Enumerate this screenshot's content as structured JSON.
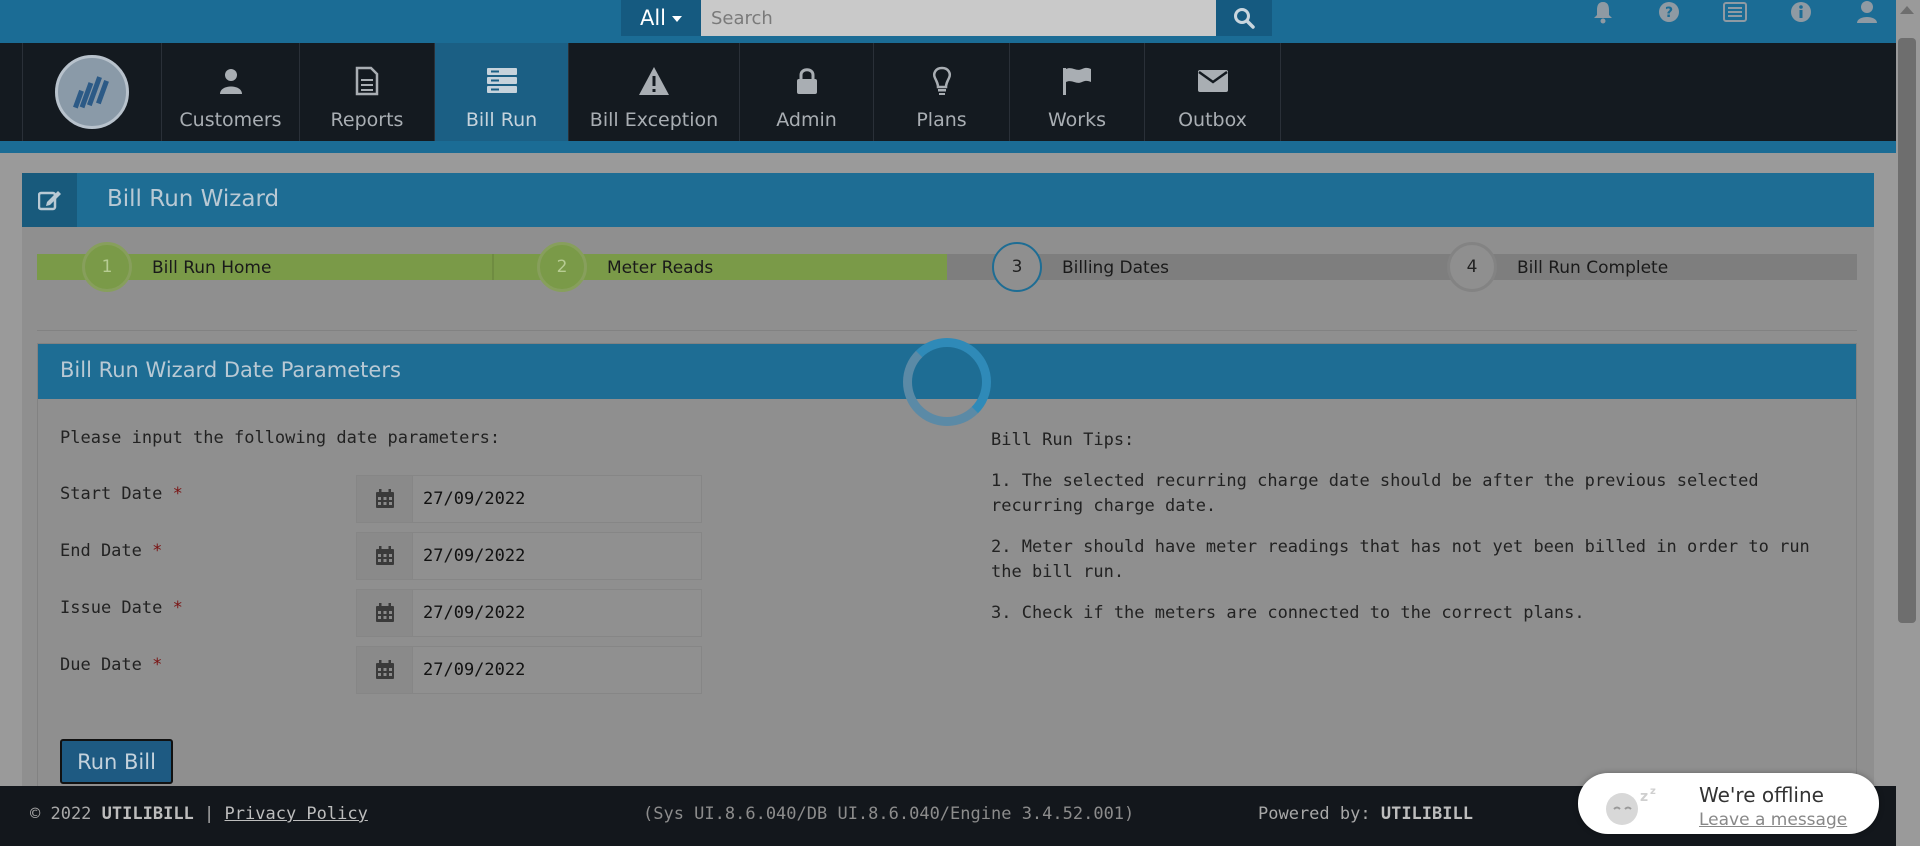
{
  "search": {
    "scope_label": "All",
    "placeholder": "Search"
  },
  "top_icons": [
    "bell-icon",
    "question-icon",
    "list-icon",
    "info-icon",
    "user-icon"
  ],
  "nav": {
    "items": [
      {
        "label": "Customers",
        "icon": "user-icon"
      },
      {
        "label": "Reports",
        "icon": "document-icon"
      },
      {
        "label": "Bill Run",
        "icon": "server-icon",
        "active": true
      },
      {
        "label": "Bill Exception",
        "icon": "warning-icon"
      },
      {
        "label": "Admin",
        "icon": "lock-icon"
      },
      {
        "label": "Plans",
        "icon": "lightbulb-icon"
      },
      {
        "label": "Works",
        "icon": "flag-icon"
      },
      {
        "label": "Outbox",
        "icon": "envelope-icon"
      }
    ]
  },
  "panel": {
    "title": "Bill Run Wizard"
  },
  "wizard": {
    "steps": [
      {
        "number": "1",
        "label": "Bill Run Home",
        "state": "done"
      },
      {
        "number": "2",
        "label": "Meter Reads",
        "state": "done"
      },
      {
        "number": "3",
        "label": "Billing Dates",
        "state": "current"
      },
      {
        "number": "4",
        "label": "Bill Run Complete",
        "state": "todo"
      }
    ]
  },
  "form": {
    "title": "Bill Run Wizard Date Parameters",
    "intro": "Please input the following date parameters:",
    "fields": [
      {
        "label": "Start Date",
        "required_mark": "*",
        "value": "27/09/2022"
      },
      {
        "label": "End Date",
        "required_mark": "*",
        "value": "27/09/2022"
      },
      {
        "label": "Issue Date",
        "required_mark": "*",
        "value": "27/09/2022"
      },
      {
        "label": "Due Date",
        "required_mark": "*",
        "value": "27/09/2022"
      }
    ],
    "submit_label": "Run Bill"
  },
  "tips": {
    "title": "Bill Run Tips:",
    "items": [
      "1. The selected recurring charge date should be after the previous selected recurring charge date.",
      "2. Meter should have meter readings that has not yet been billed in order to run the bill run.",
      "3. Check if the meters are connected to the correct plans."
    ]
  },
  "footer": {
    "copyright": "© 2022",
    "brand": "UTILIBILL",
    "separator": "|",
    "privacy_link": "Privacy Policy",
    "version": "(Sys UI.8.6.040/DB UI.8.6.040/Engine 3.4.52.001)",
    "powered_by": "Powered by:",
    "powered_brand": "UTILIBILL"
  },
  "chat": {
    "status": "We're offline",
    "link": "Leave a message"
  },
  "colors": {
    "topbar": "#1b6c95",
    "navbar": "#141a20",
    "active_nav": "#1b5f84",
    "step_done": "#7a9a48",
    "overlay_gray": "#9a9a9a"
  }
}
